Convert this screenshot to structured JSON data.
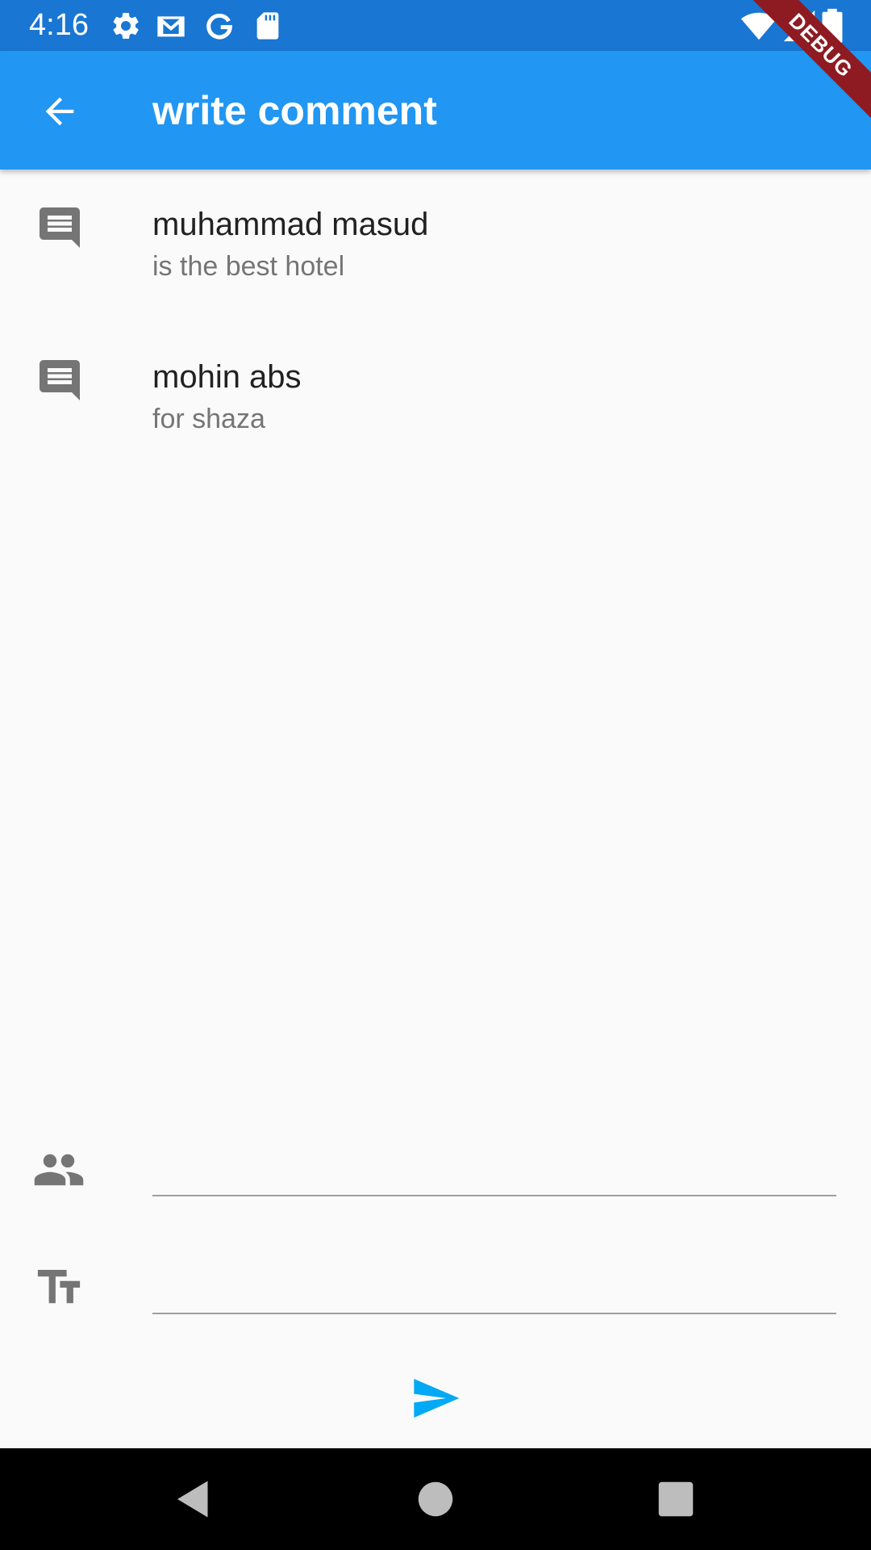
{
  "status_bar": {
    "time": "4:16",
    "icons": [
      "settings-icon",
      "gmail-icon",
      "google-icon",
      "sd-card-icon",
      "wifi-icon",
      "signal-icon",
      "battery-icon"
    ],
    "background": "#1976d2"
  },
  "app_bar": {
    "title": "write comment",
    "back_icon": "arrow-back-icon",
    "background": "#2196f3",
    "debug_banner": "DEBUG"
  },
  "comments": [
    {
      "icon": "comment-icon",
      "author": "muhammad masud",
      "text": "is the best hotel"
    },
    {
      "icon": "comment-icon",
      "author": "mohin abs",
      "text": "for shaza"
    }
  ],
  "form": {
    "name_field": {
      "icon": "people-icon",
      "value": "",
      "placeholder": ""
    },
    "comment_field": {
      "icon": "text-fields-icon",
      "value": "",
      "placeholder": ""
    },
    "send_icon": "send-icon",
    "send_color": "#03a9f4"
  },
  "nav_bar": {
    "buttons": [
      "back-triangle-icon",
      "home-circle-icon",
      "recents-square-icon"
    ]
  }
}
